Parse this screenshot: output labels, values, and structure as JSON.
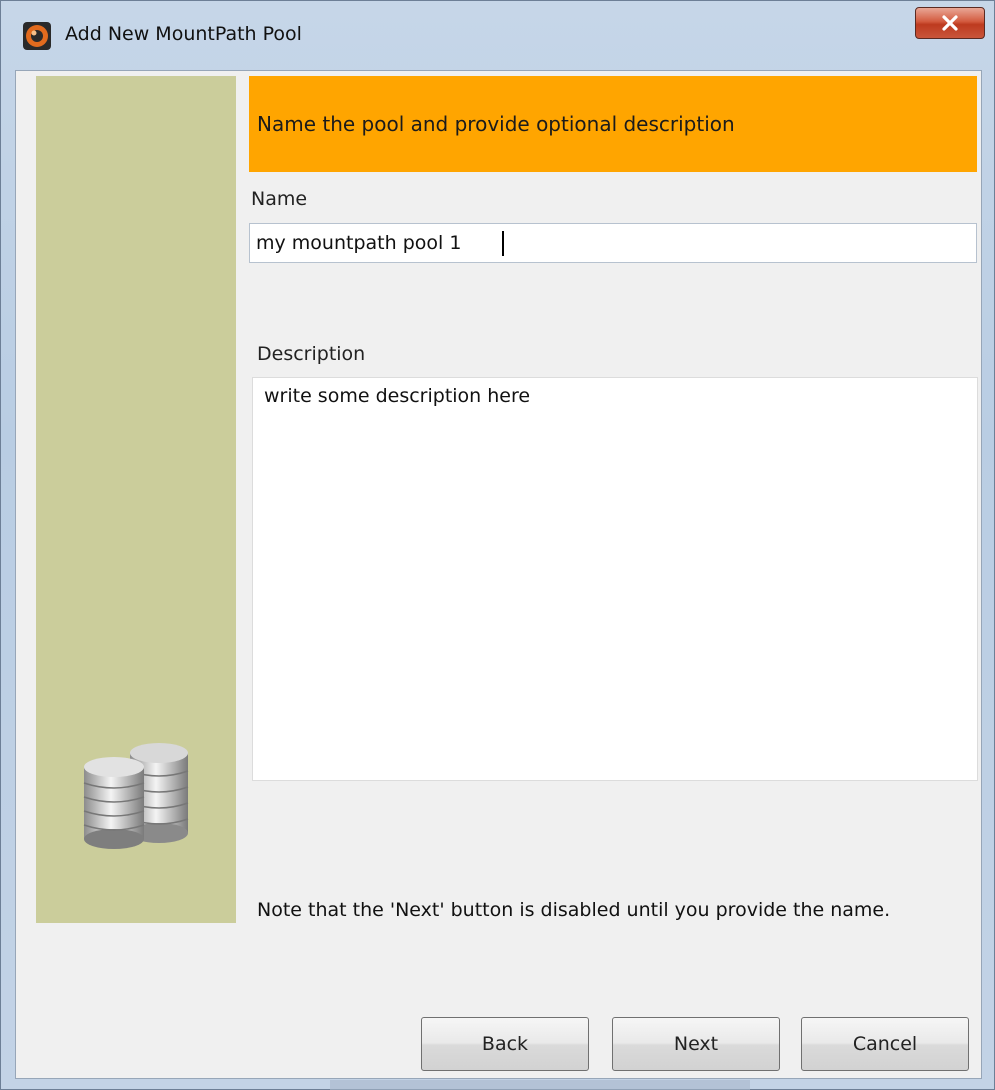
{
  "window": {
    "title": "Add New MountPath Pool",
    "close_icon": "close-icon"
  },
  "header": {
    "instruction": "Name the pool and provide optional description"
  },
  "form": {
    "name_label": "Name",
    "name_value": "my mountpath pool 1",
    "description_label": "Description",
    "description_value": "write some description here"
  },
  "note": "Note that the 'Next' button is disabled until you provide the name.",
  "buttons": {
    "back": "Back",
    "next": "Next",
    "cancel": "Cancel"
  },
  "colors": {
    "banner": "#ffa500",
    "side_panel": "#cbcd9b"
  }
}
